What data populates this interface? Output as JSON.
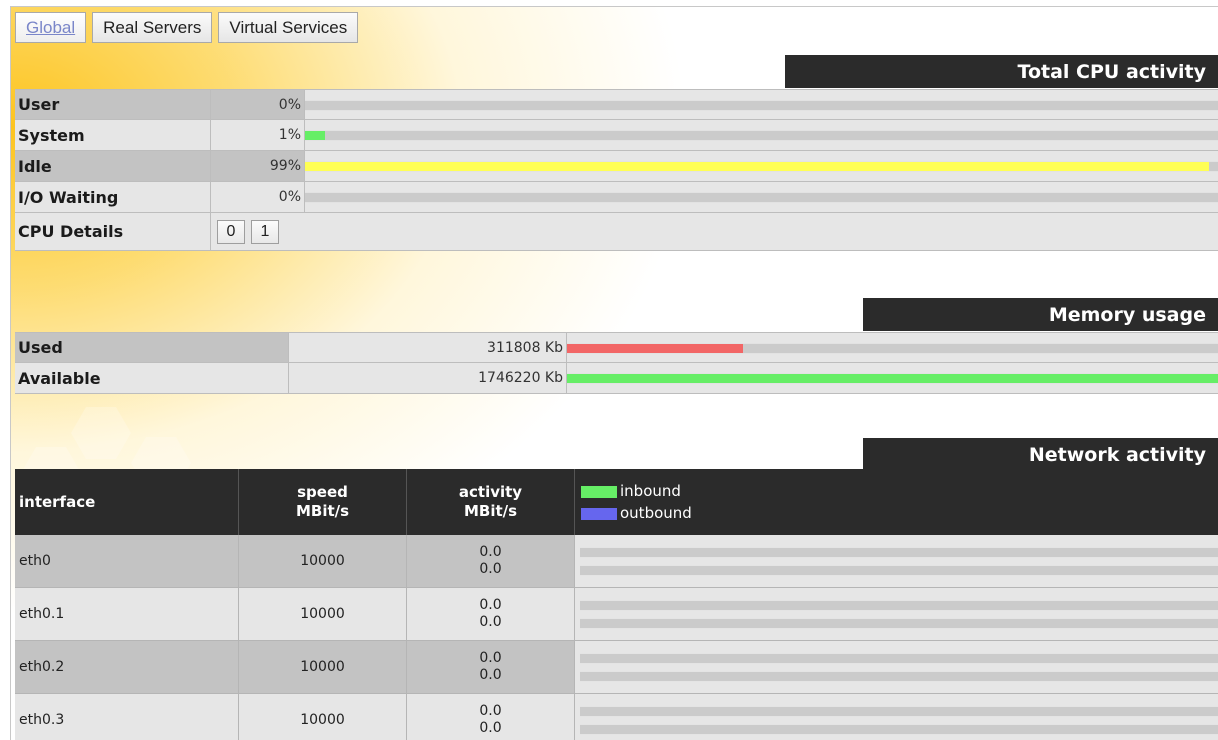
{
  "tabs": [
    {
      "label": "Global",
      "active": true
    },
    {
      "label": "Real Servers",
      "active": false
    },
    {
      "label": "Virtual Services",
      "active": false
    }
  ],
  "cpu": {
    "title": "Total CPU activity",
    "rows": [
      {
        "label": "User",
        "value": "0%",
        "level": 0,
        "color": "#66ee66"
      },
      {
        "label": "System",
        "value": "1%",
        "level": 1,
        "color": "#66ee66"
      },
      {
        "label": "Idle",
        "value": "99%",
        "level": 99,
        "color": "#ffff55"
      },
      {
        "label": "I/O Waiting",
        "value": "0%",
        "level": 0,
        "color": "#66ee66"
      }
    ],
    "details_label": "CPU Details",
    "detail_buttons": [
      "0",
      "1"
    ]
  },
  "memory": {
    "title": "Memory usage",
    "rows": [
      {
        "label": "Used",
        "value": "311808 Kb",
        "fraction": 0.27,
        "color": "#f26666"
      },
      {
        "label": "Available",
        "value": "1746220 Kb",
        "fraction": 1.0,
        "color": "#66ee66"
      }
    ]
  },
  "network": {
    "title": "Network activity",
    "headers": {
      "interface": "interface",
      "speed_1": "speed",
      "speed_2": "MBit/s",
      "activity_1": "activity",
      "activity_2": "MBit/s"
    },
    "legend": {
      "inbound": "inbound",
      "inbound_color": "#66ee66",
      "outbound": "outbound",
      "outbound_color": "#6666ee"
    },
    "rows": [
      {
        "interface": "eth0",
        "speed": "10000",
        "in": "0.0",
        "out": "0.0"
      },
      {
        "interface": "eth0.1",
        "speed": "10000",
        "in": "0.0",
        "out": "0.0"
      },
      {
        "interface": "eth0.2",
        "speed": "10000",
        "in": "0.0",
        "out": "0.0"
      },
      {
        "interface": "eth0.3",
        "speed": "10000",
        "in": "0.0",
        "out": "0.0"
      }
    ]
  }
}
